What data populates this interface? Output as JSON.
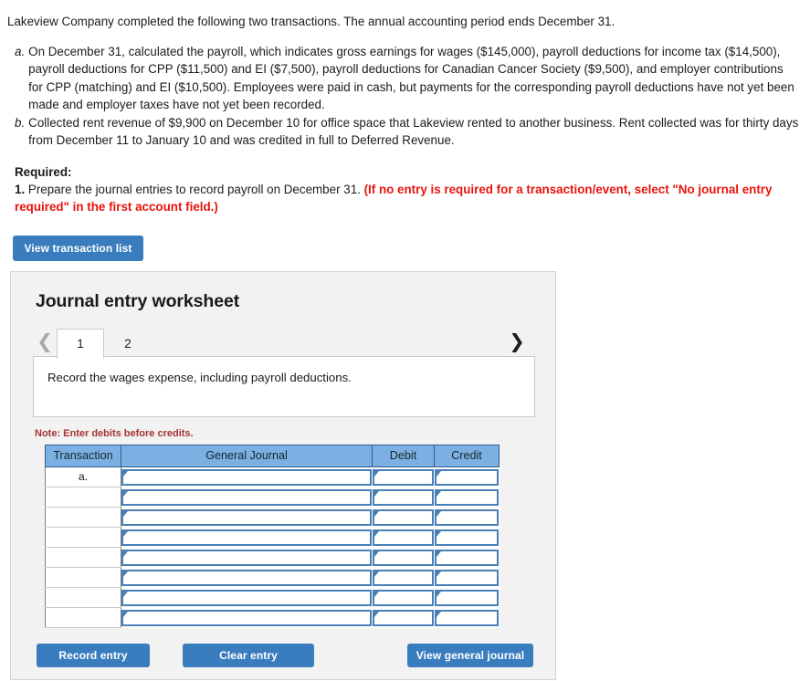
{
  "problem": {
    "intro": "Lakeview Company completed the following two transactions. The annual accounting period ends December 31.",
    "items": [
      {
        "marker": "a.",
        "text": "On December 31, calculated the payroll, which indicates gross earnings for wages ($145,000), payroll deductions for income tax ($14,500), payroll deductions for CPP ($11,500) and EI ($7,500), payroll deductions for Canadian Cancer Society ($9,500), and employer contributions for CPP (matching) and EI ($10,500). Employees were paid in cash, but payments for the corresponding payroll deductions have not yet been made and employer taxes have not yet been recorded."
      },
      {
        "marker": "b.",
        "text": "Collected rent revenue of $9,900 on December 10 for office space that Lakeview rented to another business. Rent collected was for thirty days from December 11 to January 10 and was credited in full to Deferred Revenue."
      }
    ]
  },
  "required": {
    "title": "Required:",
    "number": "1.",
    "text": " Prepare the journal entries to record payroll on December 31. ",
    "highlight": "(If no entry is required for a transaction/event, select \"No journal entry required\" in the first account field.)"
  },
  "toolbar": {
    "view_transaction_list": "View transaction list"
  },
  "worksheet": {
    "title": "Journal entry worksheet",
    "prev_icon": "chevron-left-icon",
    "next_icon": "chevron-right-icon",
    "tabs": [
      {
        "label": "1",
        "active": true
      },
      {
        "label": "2",
        "active": false
      }
    ],
    "description": "Record the wages expense, including payroll deductions.",
    "note": "Note: Enter debits before credits.",
    "table": {
      "columns": [
        "Transaction",
        "General Journal",
        "Debit",
        "Credit"
      ],
      "rows": [
        {
          "transaction": "a.",
          "general_journal": "",
          "debit": "",
          "credit": ""
        },
        {
          "transaction": "",
          "general_journal": "",
          "debit": "",
          "credit": ""
        },
        {
          "transaction": "",
          "general_journal": "",
          "debit": "",
          "credit": ""
        },
        {
          "transaction": "",
          "general_journal": "",
          "debit": "",
          "credit": ""
        },
        {
          "transaction": "",
          "general_journal": "",
          "debit": "",
          "credit": ""
        },
        {
          "transaction": "",
          "general_journal": "",
          "debit": "",
          "credit": ""
        },
        {
          "transaction": "",
          "general_journal": "",
          "debit": "",
          "credit": ""
        },
        {
          "transaction": "",
          "general_journal": "",
          "debit": "",
          "credit": ""
        }
      ]
    },
    "buttons": {
      "record_entry": "Record entry",
      "clear_entry": "Clear entry",
      "view_general_journal": "View general journal"
    }
  },
  "colors": {
    "button_blue": "#3a7dbf",
    "header_blue": "#7db0e2",
    "cell_border_blue": "#4a7fb5",
    "alert_red": "#e8140d",
    "note_red": "#a83232",
    "panel_gray": "#f2f2f2"
  }
}
